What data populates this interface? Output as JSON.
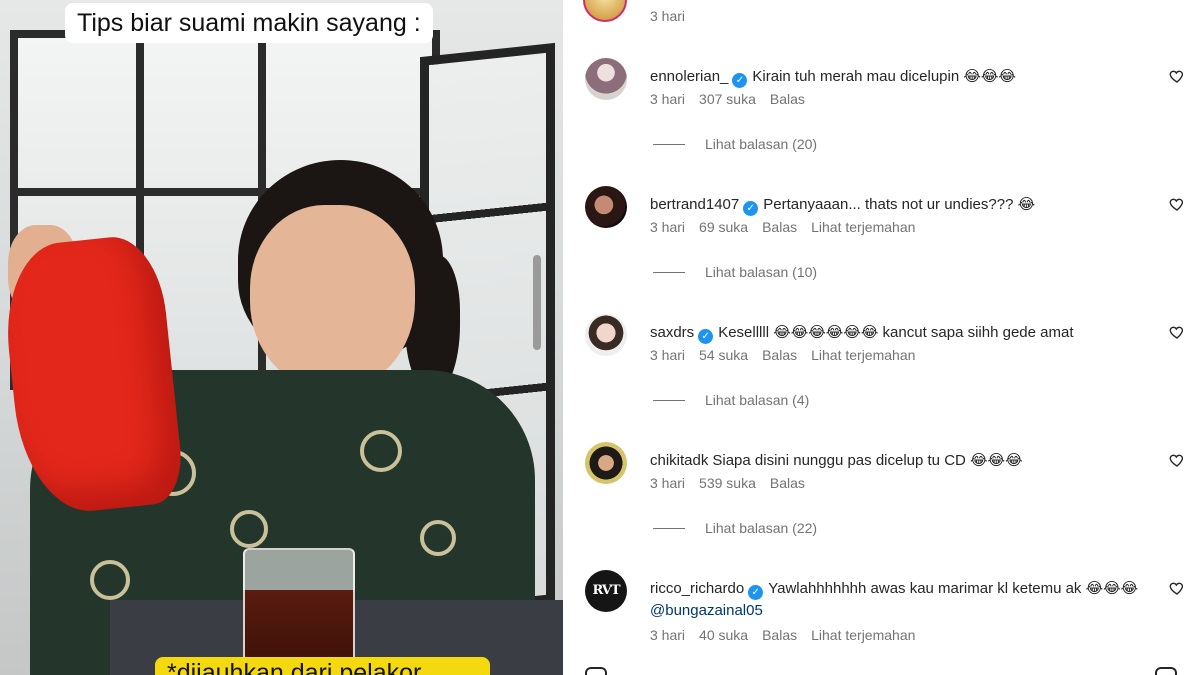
{
  "video": {
    "caption_top": "Tips biar suami makin sayang :",
    "caption_bottom": "*dijauhkan dari pelakor"
  },
  "previous_comment": {
    "time": "3 hari"
  },
  "comments": [
    {
      "username": "ennolerian_",
      "verified": true,
      "text": "Kirain tuh merah mau dicelupin 😂😂😂",
      "time": "3 hari",
      "likes": "307 suka",
      "reply": "Balas",
      "translate": "",
      "replies": "Lihat balasan (20)",
      "avatar_icon": "user-avatar-photo"
    },
    {
      "username": "bertrand1407",
      "verified": true,
      "text": "Pertanyaaan... thats not ur undies??? 😂",
      "time": "3 hari",
      "likes": "69 suka",
      "reply": "Balas",
      "translate": "Lihat terjemahan",
      "replies": "Lihat balasan (10)",
      "avatar_icon": "user-avatar-photo"
    },
    {
      "username": "saxdrs",
      "verified": true,
      "text": "Keselllll 😂😂😂😂😂😂 kancut sapa siihh gede amat",
      "time": "3 hari",
      "likes": "54 suka",
      "reply": "Balas",
      "translate": "Lihat terjemahan",
      "replies": "Lihat balasan (4)",
      "avatar_icon": "user-avatar-photo"
    },
    {
      "username": "chikitadk",
      "verified": false,
      "text": "Siapa disini nunggu pas dicelup tu CD 😂😂😂",
      "time": "3 hari",
      "likes": "539 suka",
      "reply": "Balas",
      "translate": "",
      "replies": "Lihat balasan (22)",
      "avatar_icon": "user-avatar-photo"
    },
    {
      "username": "ricco_richardo",
      "verified": true,
      "text": "Yawlahhhhhhh awas kau marimar kl ketemu ak 😂😂😂",
      "mention": "@bungazainal05",
      "time": "3 hari",
      "likes": "40 suka",
      "reply": "Balas",
      "translate": "Lihat terjemahan",
      "avatar_text": "RVT",
      "avatar_icon": "user-avatar-logo"
    }
  ],
  "icons": {
    "like": "heart-outline-icon",
    "verified": "verified-badge-icon"
  },
  "colors": {
    "verified": "#1d95f0",
    "meta_text": "#737373",
    "mention": "#00376b",
    "caption_bottom_bg": "#f4d90e",
    "cloth": "#e3271b"
  }
}
